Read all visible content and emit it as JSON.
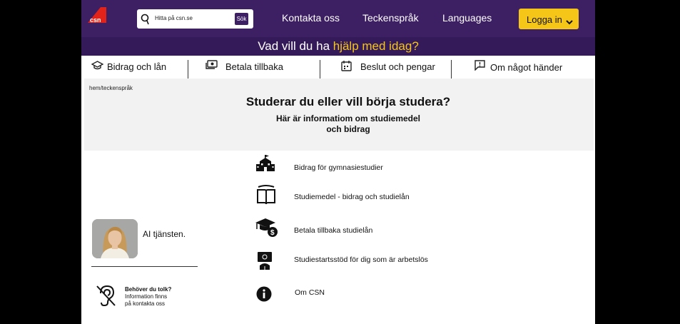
{
  "header": {
    "logo_text": "csn",
    "search": {
      "placeholder": "Hitta på csn.se",
      "button_label": "Sök"
    },
    "nav": [
      "Kontakta oss",
      "Teckenspråk",
      "Languages"
    ],
    "login_label": "Logga in"
  },
  "banner": {
    "text_plain": "Vad vill du ha ",
    "text_highlight": "hjälp med idag?"
  },
  "tabs": [
    {
      "label": "Bidrag och lån",
      "icon": "graduation-cap-icon"
    },
    {
      "label": "Betala tillbaka",
      "icon": "money-icon"
    },
    {
      "label": "Beslut och pengar",
      "icon": "calendar-icon"
    },
    {
      "label": "Om något händer",
      "icon": "message-alert-icon"
    }
  ],
  "hero": {
    "breadcrumb": "hem/teckenspråk",
    "title": "Studerar du eller vill börja studera?",
    "subtitle_line1": "Här är informatiom om studiemedel",
    "subtitle_line2": "och bidrag"
  },
  "list": [
    {
      "label": "Bidrag för gymnasiestudier",
      "icon": "school-icon"
    },
    {
      "label": "Studiemedel - bidrag och studielån",
      "icon": "book-icon"
    },
    {
      "label": "Betala tillbaka studielån",
      "icon": "graduation-payment-icon"
    },
    {
      "label": "Studiestartsstöd för dig som är arbetslös",
      "icon": "presenter-icon"
    },
    {
      "label": "Om CSN",
      "icon": "info-icon"
    }
  ],
  "ai": {
    "label": "AI tjänsten."
  },
  "tolk": {
    "title": "Behöver du tolk?",
    "line2": "Information finns",
    "line3": "på kontakta oss"
  },
  "colors": {
    "header_bg": "#3d1f63",
    "banner_bg": "#351a59",
    "accent": "#f5c518",
    "logo_red": "#e2231a"
  }
}
